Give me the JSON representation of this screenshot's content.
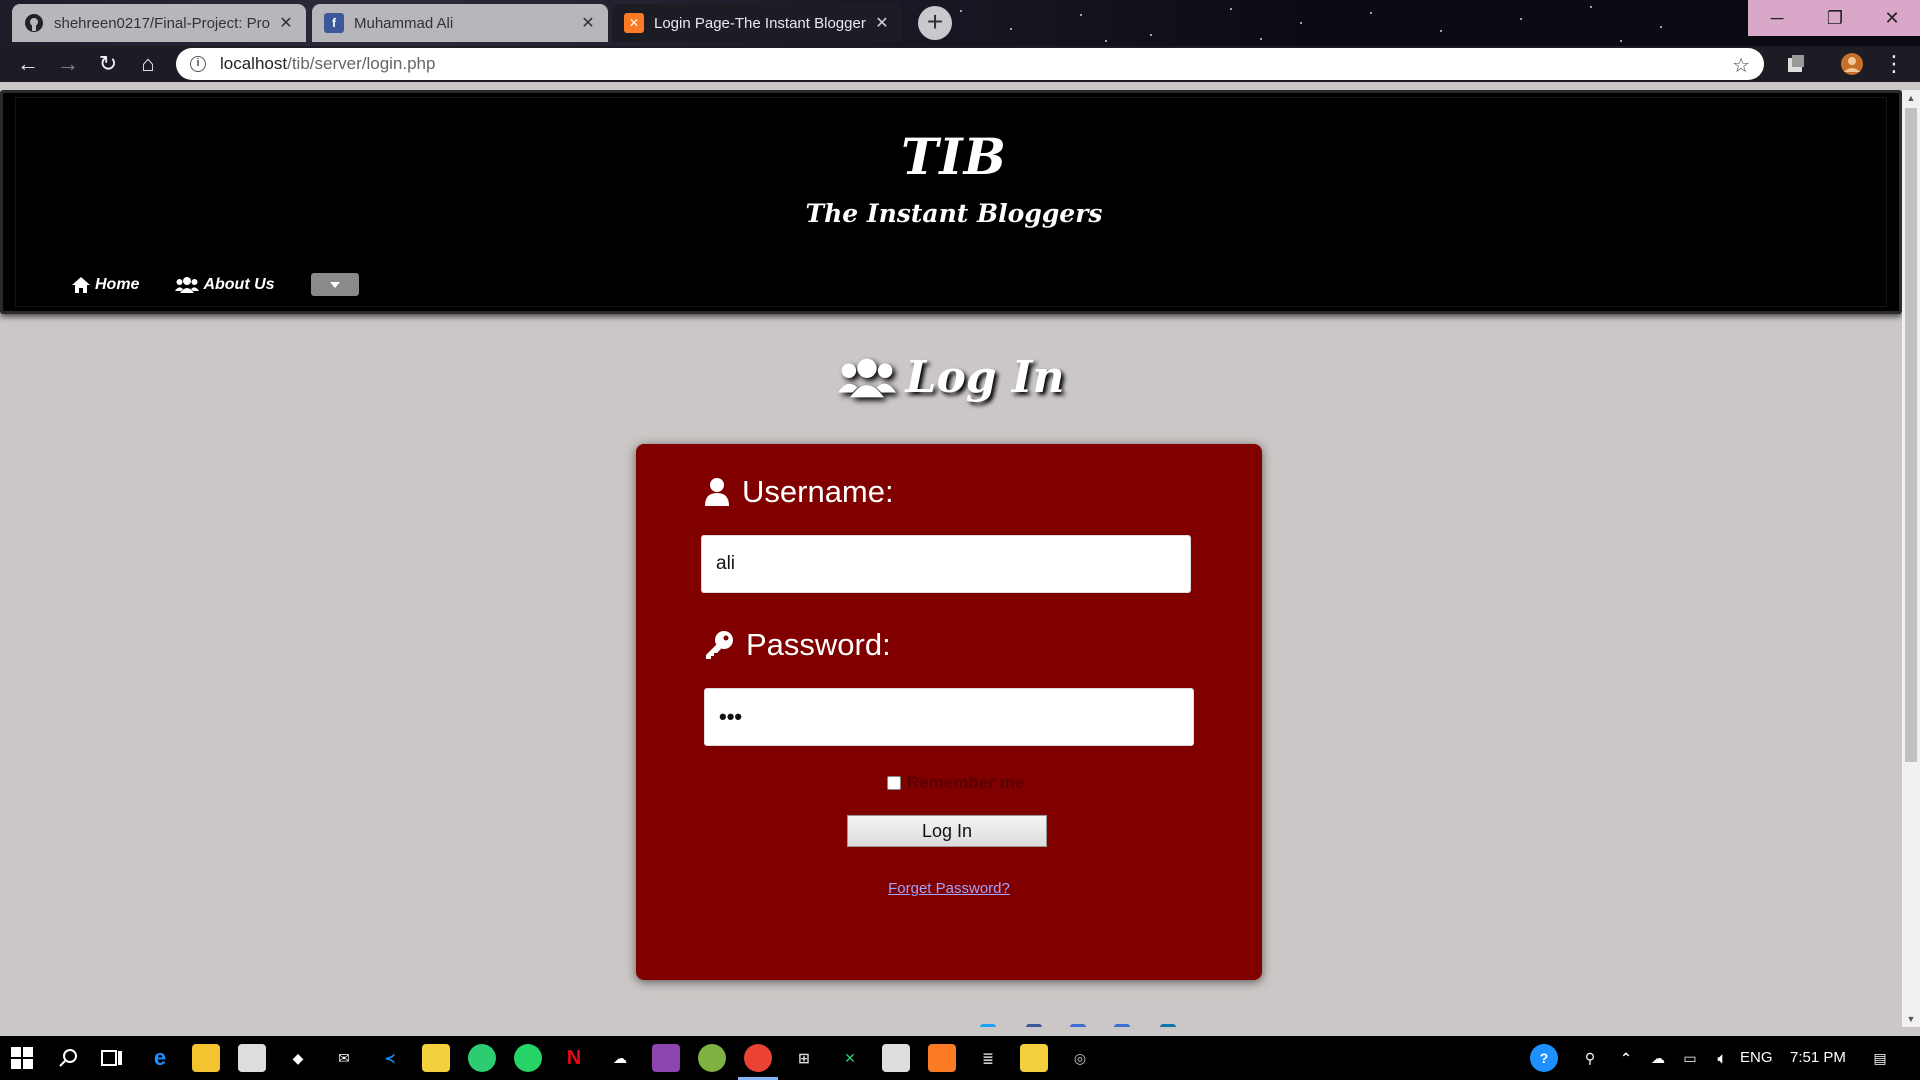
{
  "browser": {
    "tabs": [
      {
        "title": "shehreen0217/Final-Project: Pro",
        "icon": "github-icon",
        "active": false
      },
      {
        "title": "Muhammad Ali",
        "icon": "facebook-icon",
        "active": false
      },
      {
        "title": "Login Page-The Instant Bloggers",
        "icon": "xampp-icon",
        "active": true
      }
    ],
    "url_host": "localhost",
    "url_path": "/tib/server/login.php"
  },
  "site": {
    "title": "TIB",
    "subtitle": "The Instant Bloggers",
    "nav": {
      "home_label": "Home",
      "about_label": "About Us"
    }
  },
  "login": {
    "heading": "Log In",
    "username_label": "Username:",
    "username_value": "ali",
    "password_label": "Password:",
    "password_value": "•••",
    "remember_label": "Remember me",
    "remember_checked": false,
    "submit_label": "Log In",
    "forgot_label": "Forget Password?"
  },
  "taskbar": {
    "language": "ENG",
    "time": "7:51 PM"
  },
  "colors": {
    "card": "#800000",
    "page_bg": "#cbc7c6",
    "header_bg": "#000000",
    "link": "#9fa3ff"
  }
}
